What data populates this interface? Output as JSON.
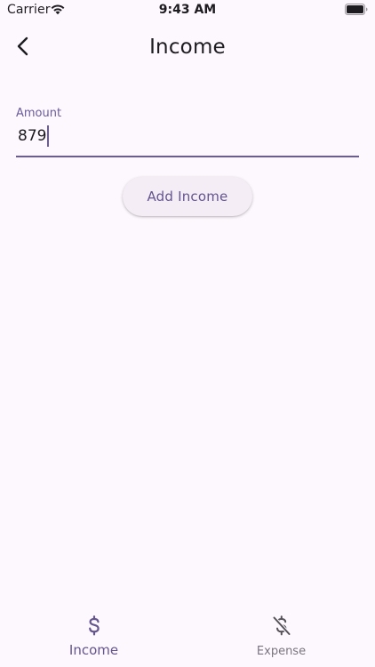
{
  "status_bar": {
    "carrier": "Carrier",
    "time": "9:43 AM"
  },
  "app_bar": {
    "title": "Income",
    "back_icon": "chevron-left-icon"
  },
  "amount_field": {
    "label": "Amount",
    "value": "879"
  },
  "add_button": {
    "label": "Add Income"
  },
  "bottom_nav": {
    "items": [
      {
        "label": "Income",
        "icon": "dollar-icon",
        "selected": true
      },
      {
        "label": "Expense",
        "icon": "dollar-off-icon",
        "selected": false
      }
    ]
  },
  "colors": {
    "background": "#fdf8fd",
    "accent": "#65558f",
    "button_bg": "#f4edf5",
    "inactive": "#7a7580"
  }
}
